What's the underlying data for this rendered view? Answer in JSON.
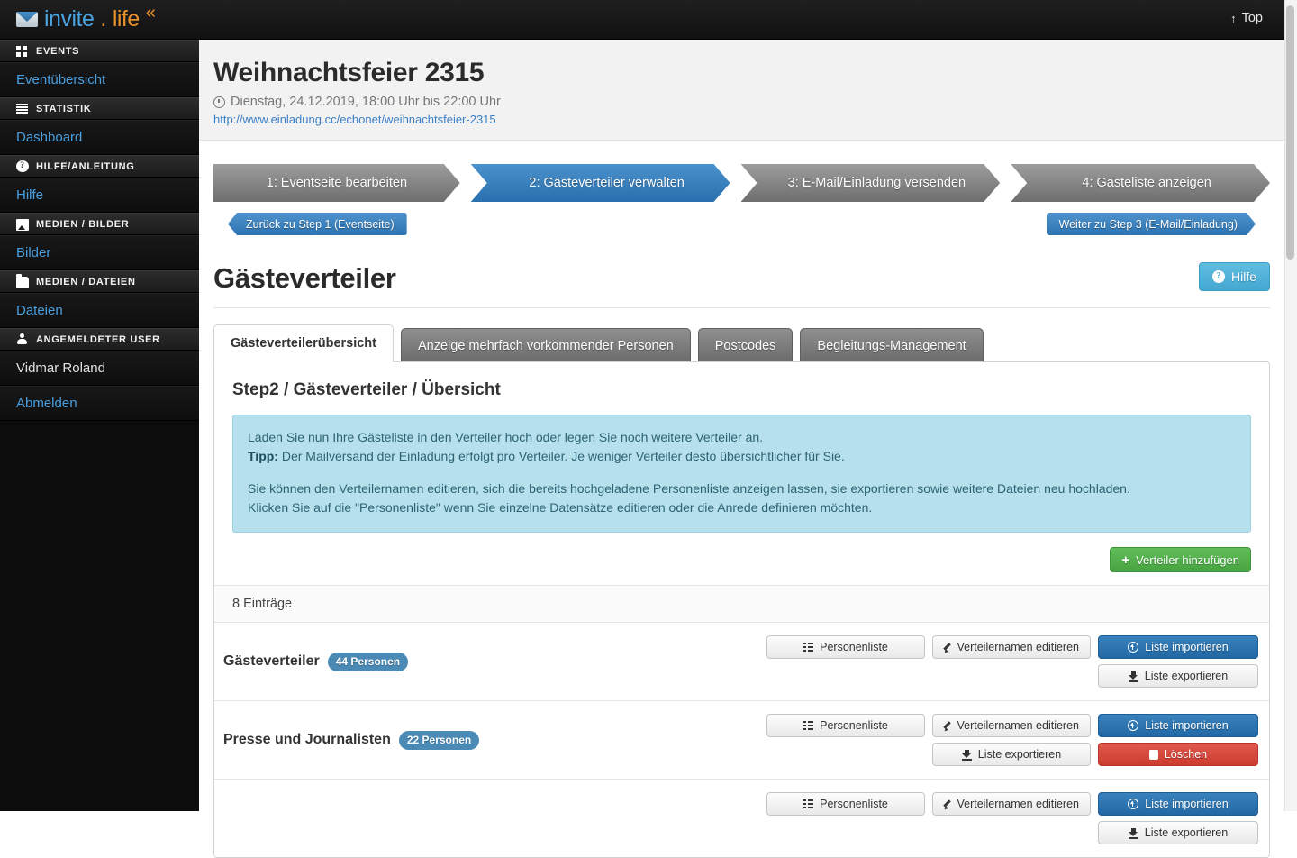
{
  "topbar": {
    "brand_part1": "invite",
    "brand_dot": ".",
    "brand_part2": "life",
    "brand_quote": "«",
    "top_label": "Top",
    "top_arrow": "↑",
    "envelope_icon": "envelope-icon"
  },
  "sidebar": {
    "groups": [
      {
        "icon": "grid-icon",
        "label": "EVENTS",
        "items": [
          {
            "label": "Eventübersicht",
            "type": "link"
          }
        ]
      },
      {
        "icon": "bars-icon",
        "label": "STATISTIK",
        "items": [
          {
            "label": "Dashboard",
            "type": "link"
          }
        ]
      },
      {
        "icon": "question-icon",
        "label": "HILFE/ANLEITUNG",
        "items": [
          {
            "label": "Hilfe",
            "type": "link"
          }
        ]
      },
      {
        "icon": "picture-icon",
        "label": "MEDIEN / BILDER",
        "items": [
          {
            "label": "Bilder",
            "type": "link"
          }
        ]
      },
      {
        "icon": "folder-icon",
        "label": "MEDIEN / DATEIEN",
        "items": [
          {
            "label": "Dateien",
            "type": "link"
          }
        ]
      },
      {
        "icon": "user-icon",
        "label": "ANGEMELDETER USER",
        "items": [
          {
            "label": "Vidmar Roland",
            "type": "text"
          },
          {
            "label": "Abmelden",
            "type": "link"
          }
        ]
      }
    ]
  },
  "event": {
    "title": "Weihnachtsfeier 2315",
    "date": "Dienstag, 24.12.2019, 18:00 Uhr bis 22:00 Uhr",
    "url": "http://www.einladung.cc/echonet/weihnachtsfeier-2315",
    "clock_icon": "clock-icon"
  },
  "steps": [
    {
      "label": "1: Eventseite bearbeiten",
      "active": false
    },
    {
      "label": "2: Gästeverteiler verwalten",
      "active": true
    },
    {
      "label": "3: E-Mail/Einladung versenden",
      "active": false
    },
    {
      "label": "4: Gästeliste anzeigen",
      "active": false
    }
  ],
  "nav": {
    "back_label": "Zurück zu Step 1 (Eventseite)",
    "next_label": "Weiter zu Step 3 (E-Mail/Einladung)"
  },
  "page": {
    "title": "Gästeverteiler",
    "help_label": "Hilfe",
    "help_icon": "question-circle-icon"
  },
  "tabs": [
    {
      "label": "Gästeverteilerübersicht",
      "active": true
    },
    {
      "label": "Anzeige mehrfach vorkommender Personen",
      "active": false
    },
    {
      "label": "Postcodes",
      "active": false
    },
    {
      "label": "Begleitungs-Management",
      "active": false
    }
  ],
  "panel": {
    "heading": "Step2 / Gästeverteiler / Übersicht",
    "info": {
      "line1": "Laden Sie nun Ihre Gästeliste in den Verteiler hoch oder legen Sie noch weitere Verteiler an.",
      "tip_label": "Tipp:",
      "tip_text": " Der Mailversand der Einladung erfolgt pro Verteiler. Je weniger Verteiler desto übersichtlicher für Sie.",
      "line3": "Sie können den Verteilernamen editieren, sich die bereits hochgeladene Personenliste anzeigen lassen, sie exportieren sowie weitere Dateien neu hochladen.",
      "line4": "Klicken Sie auf die \"Personenliste\" wenn Sie einzelne Datensätze editieren oder die Anrede definieren möchten."
    },
    "add_button": "Verteiler hinzufügen",
    "add_icon": "plus-icon",
    "count_label": "8 Einträge"
  },
  "row_buttons": {
    "personenliste": "Personenliste",
    "personenliste_icon": "list-icon",
    "editieren": "Verteilernamen editieren",
    "editieren_icon": "pencil-icon",
    "importieren": "Liste importieren",
    "importieren_icon": "upload-circle-icon",
    "exportieren": "Liste exportieren",
    "exportieren_icon": "download-icon",
    "loeschen": "Löschen",
    "loeschen_icon": "trash-icon"
  },
  "distributors": [
    {
      "name": "Gästeverteiler",
      "badge": "44 Personen",
      "has_delete": false
    },
    {
      "name": "Presse und Journalisten",
      "badge": "22 Personen",
      "has_delete": true
    },
    {
      "name": "",
      "badge": "",
      "has_delete": false
    }
  ]
}
